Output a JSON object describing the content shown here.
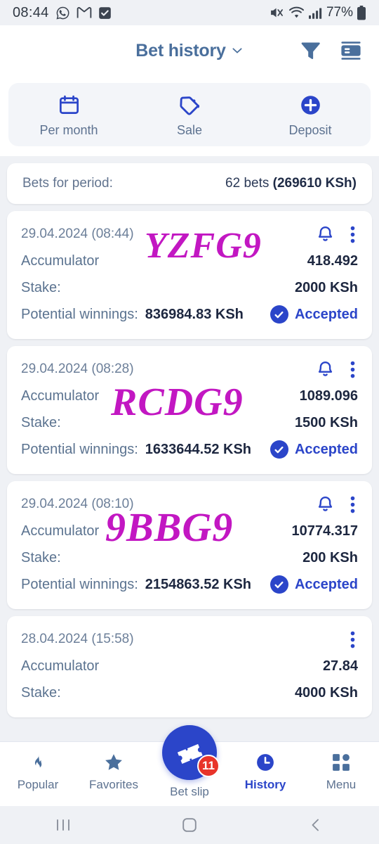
{
  "status_bar": {
    "time": "08:44",
    "battery_percent": "77%",
    "icons": [
      "whatsapp-icon",
      "gmail-icon",
      "checkbox-icon",
      "mute-icon",
      "wifi-icon",
      "signal-icon",
      "battery-icon"
    ]
  },
  "header": {
    "title": "Bet history",
    "dropdown_icon": "chevron-down-icon",
    "filter_icon": "filter-icon",
    "card_icon": "card-icon"
  },
  "quick_tabs": [
    {
      "label": "Per month",
      "icon": "calendar-icon"
    },
    {
      "label": "Sale",
      "icon": "tag-icon"
    },
    {
      "label": "Deposit",
      "icon": "plus-circle-icon"
    }
  ],
  "summary": {
    "label": "Bets for period:",
    "count": "62 bets",
    "amount": "(269610 KSh)"
  },
  "labels": {
    "accumulator": "Accumulator",
    "stake": "Stake:",
    "potential": "Potential winnings:"
  },
  "bets": [
    {
      "date": "29.04.2024 (08:44)",
      "code": "YZFG9",
      "type": "Accumulator",
      "odds": "418.492",
      "stake": "2000 KSh",
      "potential": "836984.83 KSh",
      "status": "Accepted",
      "has_bell": true
    },
    {
      "date": "29.04.2024 (08:28)",
      "code": "RCDG9",
      "type": "Accumulator",
      "odds": "1089.096",
      "stake": "1500 KSh",
      "potential": "1633644.52 KSh",
      "status": "Accepted",
      "has_bell": true
    },
    {
      "date": "29.04.2024 (08:10)",
      "code": "9BBG9",
      "type": "Accumulator",
      "odds": "10774.317",
      "stake": "200 KSh",
      "potential": "2154863.52 KSh",
      "status": "Accepted",
      "has_bell": true
    },
    {
      "date": "28.04.2024 (15:58)",
      "code": "",
      "type": "Accumulator",
      "odds": "27.84",
      "stake": "4000 KSh",
      "potential": "",
      "status": "",
      "has_bell": false
    }
  ],
  "bottom_nav": {
    "items": [
      {
        "label": "Popular",
        "icon": "flame-icon",
        "active": false
      },
      {
        "label": "Favorites",
        "icon": "star-icon",
        "active": false
      },
      {
        "label": "History",
        "icon": "clock-icon",
        "active": true
      },
      {
        "label": "Menu",
        "icon": "grid-icon",
        "active": false
      }
    ],
    "fab": {
      "label": "Bet slip",
      "icon": "ticket-icon",
      "badge": "11"
    }
  },
  "android_nav": {
    "recents": "recents-icon",
    "home": "home-icon",
    "back": "back-icon"
  },
  "colors": {
    "accent": "#2b45c9",
    "code": "#c217c2",
    "badge": "#e8342a",
    "page_bg": "#eff1f5"
  }
}
